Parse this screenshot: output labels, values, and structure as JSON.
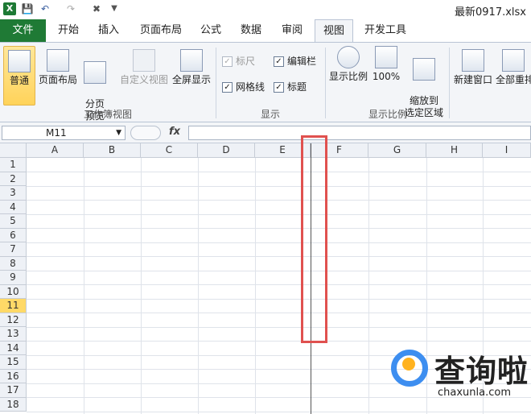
{
  "window": {
    "title": "最新0917.xlsx"
  },
  "qat": {
    "icons": [
      "excel-logo",
      "save-icon",
      "undo-icon",
      "redo-icon",
      "customize-icon"
    ],
    "logo_text": "X"
  },
  "tabs": [
    "文件",
    "开始",
    "插入",
    "页面布局",
    "公式",
    "数据",
    "审阅",
    "视图",
    "开发工具"
  ],
  "active_tab": "视图",
  "ribbon": {
    "workbook_views": {
      "label": "工作簿视图",
      "buttons": [
        "普通",
        "页面布局",
        "分页\n预览",
        "自定义视图",
        "全屏显示"
      ],
      "selected": "普通"
    },
    "show": {
      "label": "显示",
      "checkboxes": [
        {
          "label": "标尺",
          "checked": true,
          "enabled": false
        },
        {
          "label": "编辑栏",
          "checked": true,
          "enabled": true
        },
        {
          "label": "网格线",
          "checked": true,
          "enabled": true
        },
        {
          "label": "标题",
          "checked": true,
          "enabled": true
        }
      ]
    },
    "zoom": {
      "label": "显示比例",
      "buttons": [
        "显示比例",
        "100%",
        "缩放到\n选定区域"
      ]
    },
    "window_group": {
      "buttons": [
        "新建窗口",
        "全部重排"
      ]
    }
  },
  "formula_bar": {
    "name_box": "M11",
    "fx": "fx",
    "formula": ""
  },
  "grid": {
    "columns": [
      "A",
      "B",
      "C",
      "D",
      "E",
      "F",
      "G",
      "H",
      "I"
    ],
    "rows": [
      "1",
      "2",
      "3",
      "4",
      "5",
      "6",
      "7",
      "8",
      "9",
      "10",
      "11",
      "12",
      "13",
      "14",
      "15",
      "16",
      "17",
      "18"
    ],
    "selected_row": "11"
  },
  "watermark": {
    "text": "查询啦",
    "url": "chaxunla.com"
  },
  "colors": {
    "file_tab": "#1f7a35",
    "ribbon_bg": "#f3f5f8",
    "selected_row": "#ffd967",
    "highlight_box": "#e0514f",
    "watermark_blue": "#3d8ef0"
  }
}
